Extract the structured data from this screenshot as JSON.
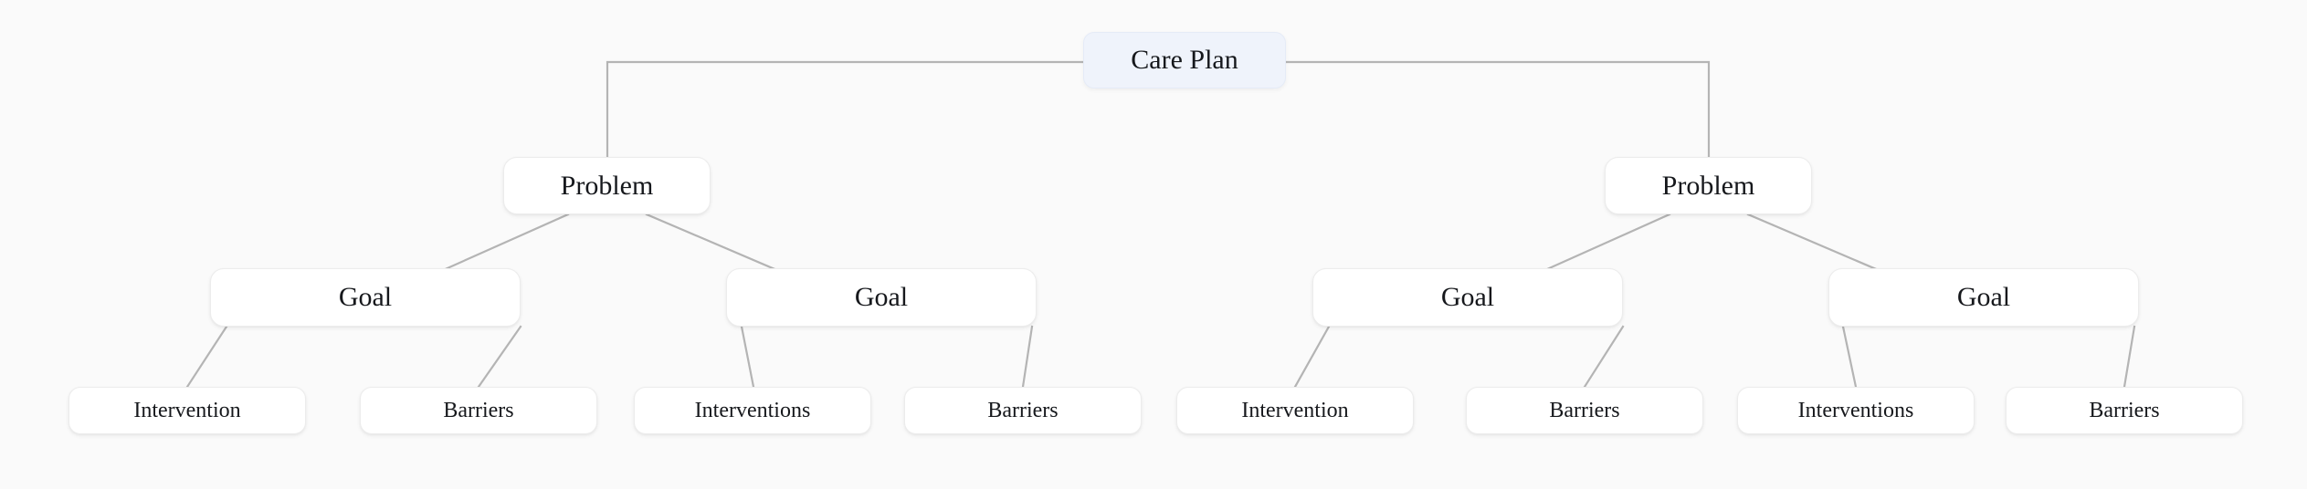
{
  "diagram": {
    "type": "tree",
    "title": "Care Plan hierarchy",
    "background_color": "#fafafa",
    "edge_color": "#b4b4b4",
    "root_node_color": "#eff3fb",
    "node_color": "#ffffff",
    "text_color": "#16181c",
    "levels": [
      "Care Plan",
      "Problem",
      "Goal",
      "Intervention / Barriers"
    ]
  },
  "nodes": {
    "root": {
      "label": "Care Plan"
    },
    "problems": [
      {
        "label": "Problem"
      },
      {
        "label": "Problem"
      }
    ],
    "goals": [
      {
        "label": "Goal"
      },
      {
        "label": "Goal"
      },
      {
        "label": "Goal"
      },
      {
        "label": "Goal"
      }
    ],
    "leaves": [
      {
        "label": "Intervention"
      },
      {
        "label": "Barriers"
      },
      {
        "label": "Interventions"
      },
      {
        "label": "Barriers"
      },
      {
        "label": "Intervention"
      },
      {
        "label": "Barriers"
      },
      {
        "label": "Interventions"
      },
      {
        "label": "Barriers"
      }
    ]
  }
}
